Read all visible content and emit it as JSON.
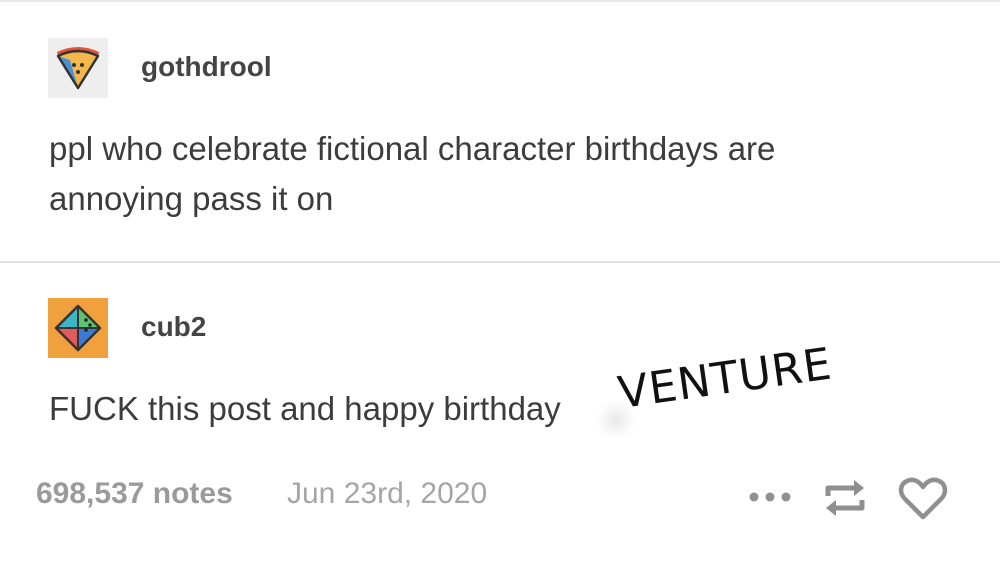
{
  "posts": [
    {
      "username": "gothdrool",
      "avatar_icon": "pizza-slice-icon",
      "body": [
        "ppl who celebrate fictional character birthdays are",
        "annoying pass it on"
      ]
    },
    {
      "username": "cub2",
      "avatar_icon": "octahedron-icon",
      "body": [
        "FUCK this post and happy birthday"
      ],
      "sticker_text": "VENTURE"
    }
  ],
  "footer": {
    "notes": "698,537 notes",
    "date": "Jun 23rd, 2020",
    "actions": [
      "more-options-icon",
      "reblog-icon",
      "heart-icon"
    ]
  },
  "colors": {
    "avatar1_bg": "#eeeeee",
    "avatar2_bg": "#f0a03c",
    "meta_text": "#9a9a9a",
    "divider": "#dedede"
  }
}
